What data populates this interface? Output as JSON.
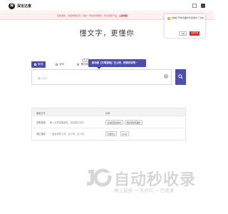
{
  "header": {
    "logo_glyph": "深",
    "logo_text": "深言达意"
  },
  "notice": {
    "text": "功能更新，无需再重复问；当前一键先登录服务；我们更新产品",
    "highlight": "立即到账"
  },
  "hero": {
    "title": "懂文字，更懂你"
  },
  "tabs": [
    {
      "label": "查词"
    },
    {
      "label": "找句"
    },
    {
      "label": "素材库"
    }
  ],
  "beta_label": "Beta",
  "tooltip": {
    "text": "新功能【文笔润色】已上线，快来试试吧~"
  },
  "search": {
    "placeholder": "输入文字"
  },
  "table": {
    "headers": [
      "使用方式",
      "示例"
    ],
    "rows": [
      {
        "mode": "意思查找",
        "desc": "输入意思或者描述，找到表达句式",
        "examples": [
          "表演结束后休息",
          "轻松愉快有趣的"
        ]
      },
      {
        "mode": "词汇找词",
        "desc": "一键查找同义词、近义词、反义词",
        "examples": [
          "不要走以",
          "shop"
        ]
      }
    ]
  },
  "popup": {
    "text": "当前打开的页面中已经选中了文本",
    "cancel_label": "以后",
    "ok_label": "立即开启"
  },
  "watermark": {
    "title": "自动秒收录",
    "subtitle": "做上链接 → 未访问 → 已收录"
  },
  "colors": {
    "accent": "#4b4fae",
    "notice_text": "#d9534f",
    "popup_ok": "#c9302c"
  }
}
